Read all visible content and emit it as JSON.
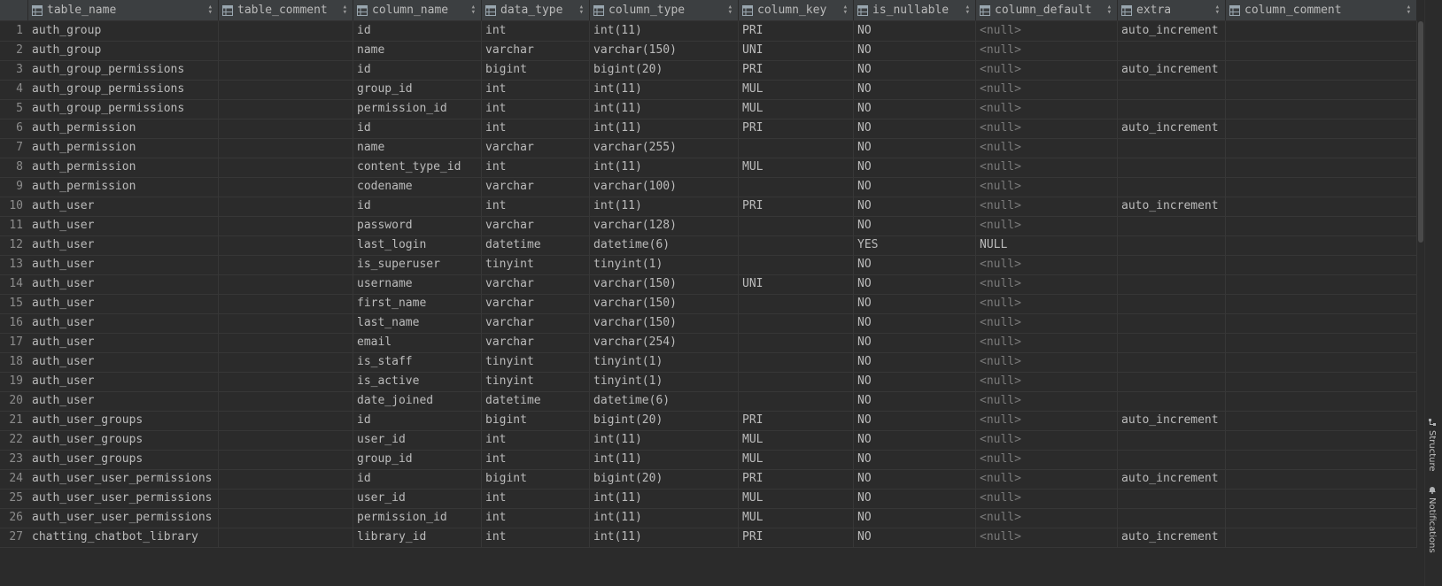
{
  "columns": [
    "table_name",
    "table_comment",
    "column_name",
    "data_type",
    "column_type",
    "column_key",
    "is_nullable",
    "column_default",
    "extra",
    "column_comment"
  ],
  "rows": [
    [
      "1",
      "auth_group",
      "",
      "id",
      "int",
      "int(11)",
      "PRI",
      "NO",
      "<null>",
      "auto_increment",
      ""
    ],
    [
      "2",
      "auth_group",
      "",
      "name",
      "varchar",
      "varchar(150)",
      "UNI",
      "NO",
      "<null>",
      "",
      ""
    ],
    [
      "3",
      "auth_group_permissions",
      "",
      "id",
      "bigint",
      "bigint(20)",
      "PRI",
      "NO",
      "<null>",
      "auto_increment",
      ""
    ],
    [
      "4",
      "auth_group_permissions",
      "",
      "group_id",
      "int",
      "int(11)",
      "MUL",
      "NO",
      "<null>",
      "",
      ""
    ],
    [
      "5",
      "auth_group_permissions",
      "",
      "permission_id",
      "int",
      "int(11)",
      "MUL",
      "NO",
      "<null>",
      "",
      ""
    ],
    [
      "6",
      "auth_permission",
      "",
      "id",
      "int",
      "int(11)",
      "PRI",
      "NO",
      "<null>",
      "auto_increment",
      ""
    ],
    [
      "7",
      "auth_permission",
      "",
      "name",
      "varchar",
      "varchar(255)",
      "",
      "NO",
      "<null>",
      "",
      ""
    ],
    [
      "8",
      "auth_permission",
      "",
      "content_type_id",
      "int",
      "int(11)",
      "MUL",
      "NO",
      "<null>",
      "",
      ""
    ],
    [
      "9",
      "auth_permission",
      "",
      "codename",
      "varchar",
      "varchar(100)",
      "",
      "NO",
      "<null>",
      "",
      ""
    ],
    [
      "10",
      "auth_user",
      "",
      "id",
      "int",
      "int(11)",
      "PRI",
      "NO",
      "<null>",
      "auto_increment",
      ""
    ],
    [
      "11",
      "auth_user",
      "",
      "password",
      "varchar",
      "varchar(128)",
      "",
      "NO",
      "<null>",
      "",
      ""
    ],
    [
      "12",
      "auth_user",
      "",
      "last_login",
      "datetime",
      "datetime(6)",
      "",
      "YES",
      "NULL",
      "",
      ""
    ],
    [
      "13",
      "auth_user",
      "",
      "is_superuser",
      "tinyint",
      "tinyint(1)",
      "",
      "NO",
      "<null>",
      "",
      ""
    ],
    [
      "14",
      "auth_user",
      "",
      "username",
      "varchar",
      "varchar(150)",
      "UNI",
      "NO",
      "<null>",
      "",
      ""
    ],
    [
      "15",
      "auth_user",
      "",
      "first_name",
      "varchar",
      "varchar(150)",
      "",
      "NO",
      "<null>",
      "",
      ""
    ],
    [
      "16",
      "auth_user",
      "",
      "last_name",
      "varchar",
      "varchar(150)",
      "",
      "NO",
      "<null>",
      "",
      ""
    ],
    [
      "17",
      "auth_user",
      "",
      "email",
      "varchar",
      "varchar(254)",
      "",
      "NO",
      "<null>",
      "",
      ""
    ],
    [
      "18",
      "auth_user",
      "",
      "is_staff",
      "tinyint",
      "tinyint(1)",
      "",
      "NO",
      "<null>",
      "",
      ""
    ],
    [
      "19",
      "auth_user",
      "",
      "is_active",
      "tinyint",
      "tinyint(1)",
      "",
      "NO",
      "<null>",
      "",
      ""
    ],
    [
      "20",
      "auth_user",
      "",
      "date_joined",
      "datetime",
      "datetime(6)",
      "",
      "NO",
      "<null>",
      "",
      ""
    ],
    [
      "21",
      "auth_user_groups",
      "",
      "id",
      "bigint",
      "bigint(20)",
      "PRI",
      "NO",
      "<null>",
      "auto_increment",
      ""
    ],
    [
      "22",
      "auth_user_groups",
      "",
      "user_id",
      "int",
      "int(11)",
      "MUL",
      "NO",
      "<null>",
      "",
      ""
    ],
    [
      "23",
      "auth_user_groups",
      "",
      "group_id",
      "int",
      "int(11)",
      "MUL",
      "NO",
      "<null>",
      "",
      ""
    ],
    [
      "24",
      "auth_user_user_permissions",
      "",
      "id",
      "bigint",
      "bigint(20)",
      "PRI",
      "NO",
      "<null>",
      "auto_increment",
      ""
    ],
    [
      "25",
      "auth_user_user_permissions",
      "",
      "user_id",
      "int",
      "int(11)",
      "MUL",
      "NO",
      "<null>",
      "",
      ""
    ],
    [
      "26",
      "auth_user_user_permissions",
      "",
      "permission_id",
      "int",
      "int(11)",
      "MUL",
      "NO",
      "<null>",
      "",
      ""
    ],
    [
      "27",
      "chatting_chatbot_library",
      "",
      "library_id",
      "int",
      "int(11)",
      "PRI",
      "NO",
      "<null>",
      "auto_increment",
      ""
    ]
  ],
  "sidebar": {
    "structure_label": "Structure",
    "notifications_label": "Notifications"
  },
  "icons": {
    "column_header": "table-column-icon",
    "sort": "sort-arrows-icon",
    "structure": "structure-icon",
    "notifications": "bell-icon"
  }
}
